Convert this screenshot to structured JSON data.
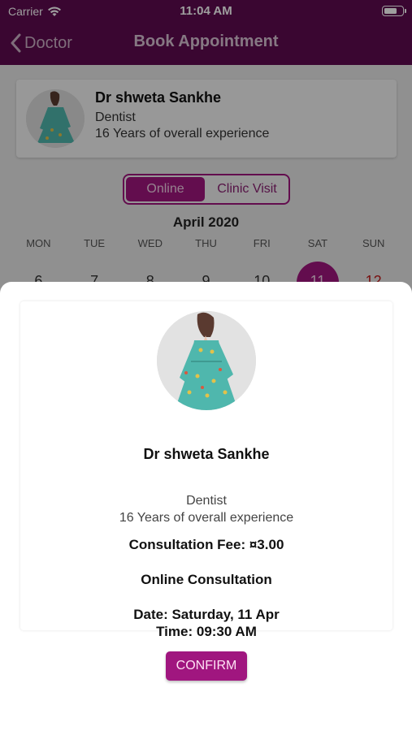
{
  "status_bar": {
    "carrier": "Carrier",
    "time": "11:04 AM"
  },
  "nav": {
    "back_label": "Doctor",
    "title": "Book Appointment"
  },
  "doctor_card": {
    "name": "Dr shweta Sankhe",
    "specialty": "Dentist",
    "experience": "16 Years of overall experience"
  },
  "mode_toggle": {
    "options": [
      "Online",
      "Clinic Visit"
    ],
    "selected": "Online"
  },
  "calendar": {
    "month": "April 2020",
    "weekdays": [
      "MON",
      "TUE",
      "WED",
      "THU",
      "FRI",
      "SAT",
      "SUN"
    ],
    "dates": [
      "6",
      "7",
      "8",
      "9",
      "10",
      "11",
      "12"
    ],
    "selected_date": "11"
  },
  "modal": {
    "name": "Dr shweta Sankhe",
    "specialty": "Dentist",
    "experience": "16 Years of overall experience",
    "fee": "Consultation Fee: ¤3.00",
    "consultation_type": "Online Consultation",
    "date": "Date: Saturday, 11 Apr",
    "time": "Time: 09:30 AM",
    "confirm_label": "CONFIRM"
  },
  "colors": {
    "header": "#5e0a4f",
    "accent": "#a0167f",
    "sunday": "#c21a1a"
  }
}
